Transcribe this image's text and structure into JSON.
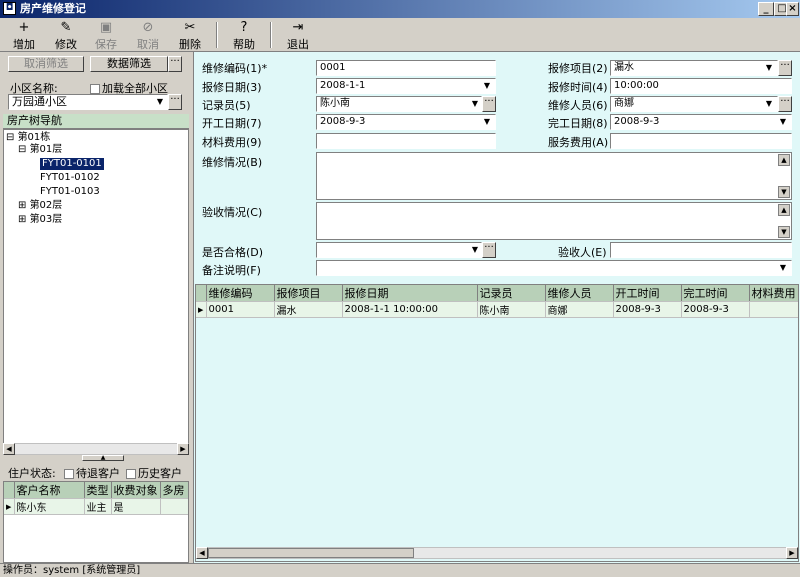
{
  "window": {
    "title": "房产维修登记",
    "min": "_",
    "max": "□",
    "close": "×"
  },
  "toolbar": [
    {
      "label": "增加",
      "icon": "+",
      "enabled": true
    },
    {
      "label": "修改",
      "icon": "✎",
      "enabled": true
    },
    {
      "label": "保存",
      "icon": "▣",
      "enabled": false
    },
    {
      "label": "取消",
      "icon": "⊘",
      "enabled": false
    },
    {
      "label": "删除",
      "icon": "✂",
      "enabled": true
    },
    {
      "label": "帮助",
      "icon": "?",
      "enabled": true
    },
    {
      "label": "退出",
      "icon": "⇥",
      "enabled": true
    }
  ],
  "left": {
    "cancel_filter": "取消筛选",
    "data_filter": "数据筛选",
    "community_label": "小区名称:",
    "load_all_label": "加载全部小区",
    "community_value": "万园通小区",
    "tree_header": "房产树导航",
    "tree": {
      "building1": "第01栋",
      "floor1": "第01层",
      "room1": "FYT01-0101",
      "room2": "FYT01-0102",
      "room3": "FYT01-0103",
      "floor2": "第02层",
      "floor3": "第03层"
    },
    "tenant_status_label": "住户状态:",
    "pending_label": "待退客户",
    "history_label": "历史客户",
    "tenant_columns": [
      "客户名称",
      "类型",
      "收费对象",
      "多房"
    ],
    "tenant_rows": [
      [
        "陈小东",
        "业主",
        "是",
        ""
      ]
    ]
  },
  "form": {
    "repair_no_label": "维修编码(1)*",
    "repair_no": "0001",
    "repair_item_label": "报修项目(2)",
    "repair_item": "漏水",
    "report_date_label": "报修日期(3)",
    "report_date": "2008-1-1",
    "report_time_label": "报修时间(4)",
    "report_time": "10:00:00",
    "recorder_label": "记录员(5)",
    "recorder": "陈小南",
    "repairer_label": "维修人员(6)",
    "repairer": "商娜",
    "start_date_label": "开工日期(7)",
    "start_date": "2008-9-3",
    "finish_date_label": "完工日期(8)",
    "finish_date": "2008-9-3",
    "material_label": "材料费用(9)",
    "material": "",
    "service_label": "服务费用(A)",
    "service": "",
    "repair_desc_label": "维修情况(B)",
    "accept_desc_label": "验收情况(C)",
    "qualified_label": "是否合格(D)",
    "acceptor_label": "验收人(E)",
    "remark_label": "备注说明(F)"
  },
  "grid": {
    "columns": [
      "维修编码",
      "报修项目",
      "报修日期",
      "记录员",
      "维修人员",
      "开工时间",
      "完工时间",
      "材料费用"
    ],
    "rows": [
      [
        "0001",
        "漏水",
        "2008-1-1 10:00:00",
        "陈小南",
        "商娜",
        "2008-9-3",
        "2008-9-3",
        ""
      ]
    ]
  },
  "status": {
    "operator": "操作员：system [系统管理员]"
  }
}
